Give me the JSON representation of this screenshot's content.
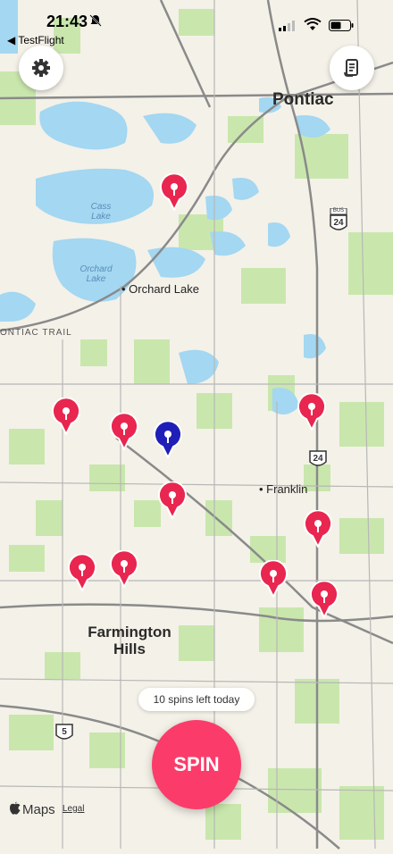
{
  "status_bar": {
    "time": "21:43",
    "back_app": "◀ TestFlight"
  },
  "map": {
    "cities": [
      {
        "name": "Pontiac"
      },
      {
        "name": "Farmington Hills"
      }
    ],
    "places": [
      "Orchard Lake",
      "Franklin"
    ],
    "lakes": [
      "Cass Lake",
      "Orchard Lake"
    ],
    "roads": [
      "ONTIAC TRAIL"
    ],
    "shields": [
      "24",
      "24",
      "5"
    ],
    "shield_tag": "BUS",
    "pin_colors": {
      "red": "#e8264f",
      "blue": "#1f1fb8"
    }
  },
  "controls": {
    "spins_left": "10 spins left today",
    "spin_label": "SPIN",
    "maps_label": "Maps",
    "legal_label": "Legal"
  },
  "colors": {
    "accent": "#fb3c6a",
    "water": "#9fd3f0",
    "park": "#c5e8a8"
  }
}
